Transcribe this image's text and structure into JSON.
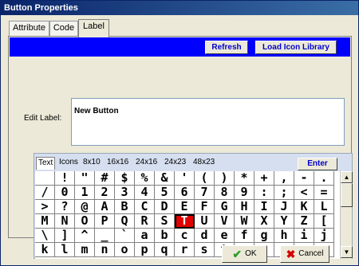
{
  "window": {
    "title": "Button Properties"
  },
  "tabs": [
    {
      "label": "Attribute",
      "active": false
    },
    {
      "label": "Code",
      "active": false
    },
    {
      "label": "Label",
      "active": true
    }
  ],
  "toolbar": {
    "refresh_label": "Refresh",
    "load_icon_library_label": "Load Icon Library",
    "accent_color": "#0000ff"
  },
  "edit_label": {
    "label": "Edit Label:",
    "value": "New Button"
  },
  "char_panel": {
    "tabs": [
      "Text",
      "Icons",
      "8x10",
      "16x16",
      "24x16",
      "24x23",
      "48x23"
    ],
    "active_tab": "Text",
    "enter_label": "Enter",
    "selected_char": "T",
    "selected_color": "#e00000",
    "rows": [
      [
        "",
        "!",
        "\"",
        "#",
        "$",
        "%",
        "&",
        "'",
        "(",
        ")",
        "*",
        "+",
        ",",
        "-",
        "."
      ],
      [
        "/",
        "0",
        "1",
        "2",
        "3",
        "4",
        "5",
        "6",
        "7",
        "8",
        "9",
        ":",
        ";",
        "<",
        "="
      ],
      [
        ">",
        "?",
        "@",
        "A",
        "B",
        "C",
        "D",
        "E",
        "F",
        "G",
        "H",
        "I",
        "J",
        "K",
        "L"
      ],
      [
        "M",
        "N",
        "O",
        "P",
        "Q",
        "R",
        "S",
        "T",
        "U",
        "V",
        "W",
        "X",
        "Y",
        "Z",
        "["
      ],
      [
        "\\",
        "]",
        "^",
        "_",
        "`",
        "a",
        "b",
        "c",
        "d",
        "e",
        "f",
        "g",
        "h",
        "i",
        "j"
      ],
      [
        "k",
        "l",
        "m",
        "n",
        "o",
        "p",
        "q",
        "r",
        "s",
        "t",
        "u",
        "v",
        "w",
        "x",
        "y"
      ]
    ]
  },
  "dialog_buttons": {
    "ok_label": "OK",
    "cancel_label": "Cancel"
  }
}
